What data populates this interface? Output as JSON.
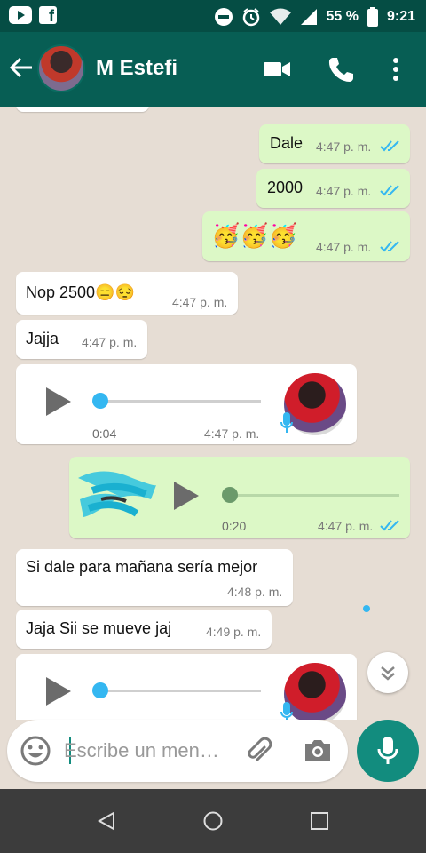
{
  "status_bar": {
    "battery": "55 %",
    "time": "9:21"
  },
  "header": {
    "back_icon": "arrow-left-icon",
    "contact_name": "M Estefi"
  },
  "messages": [
    {
      "text": "Dale",
      "time": "4:47 p. m."
    },
    {
      "text": "2000",
      "time": "4:47 p. m."
    },
    {
      "text": "🥳🥳🥳",
      "time": "4:47 p. m."
    },
    {
      "text": "Nop 2500😑😔",
      "time": "4:47 p. m."
    },
    {
      "text": "Jajja",
      "time": "4:47 p. m."
    },
    {
      "duration": "0:04",
      "time": "4:47 p. m."
    },
    {
      "duration": "0:20",
      "time": "4:47 p. m."
    },
    {
      "text": "Si dale para mañana sería mejor",
      "time": "4:48 p. m."
    },
    {
      "text": "Jaja Sii se mueve jaj",
      "time": "4:49 p. m."
    }
  ],
  "input": {
    "placeholder": "Escribe un men…"
  },
  "colors": {
    "header": "#075e54",
    "status": "#054d44",
    "outgoing": "#dcf8c6",
    "incoming": "#ffffff",
    "read_ticks": "#34b7f1",
    "accent": "#128c7e"
  }
}
